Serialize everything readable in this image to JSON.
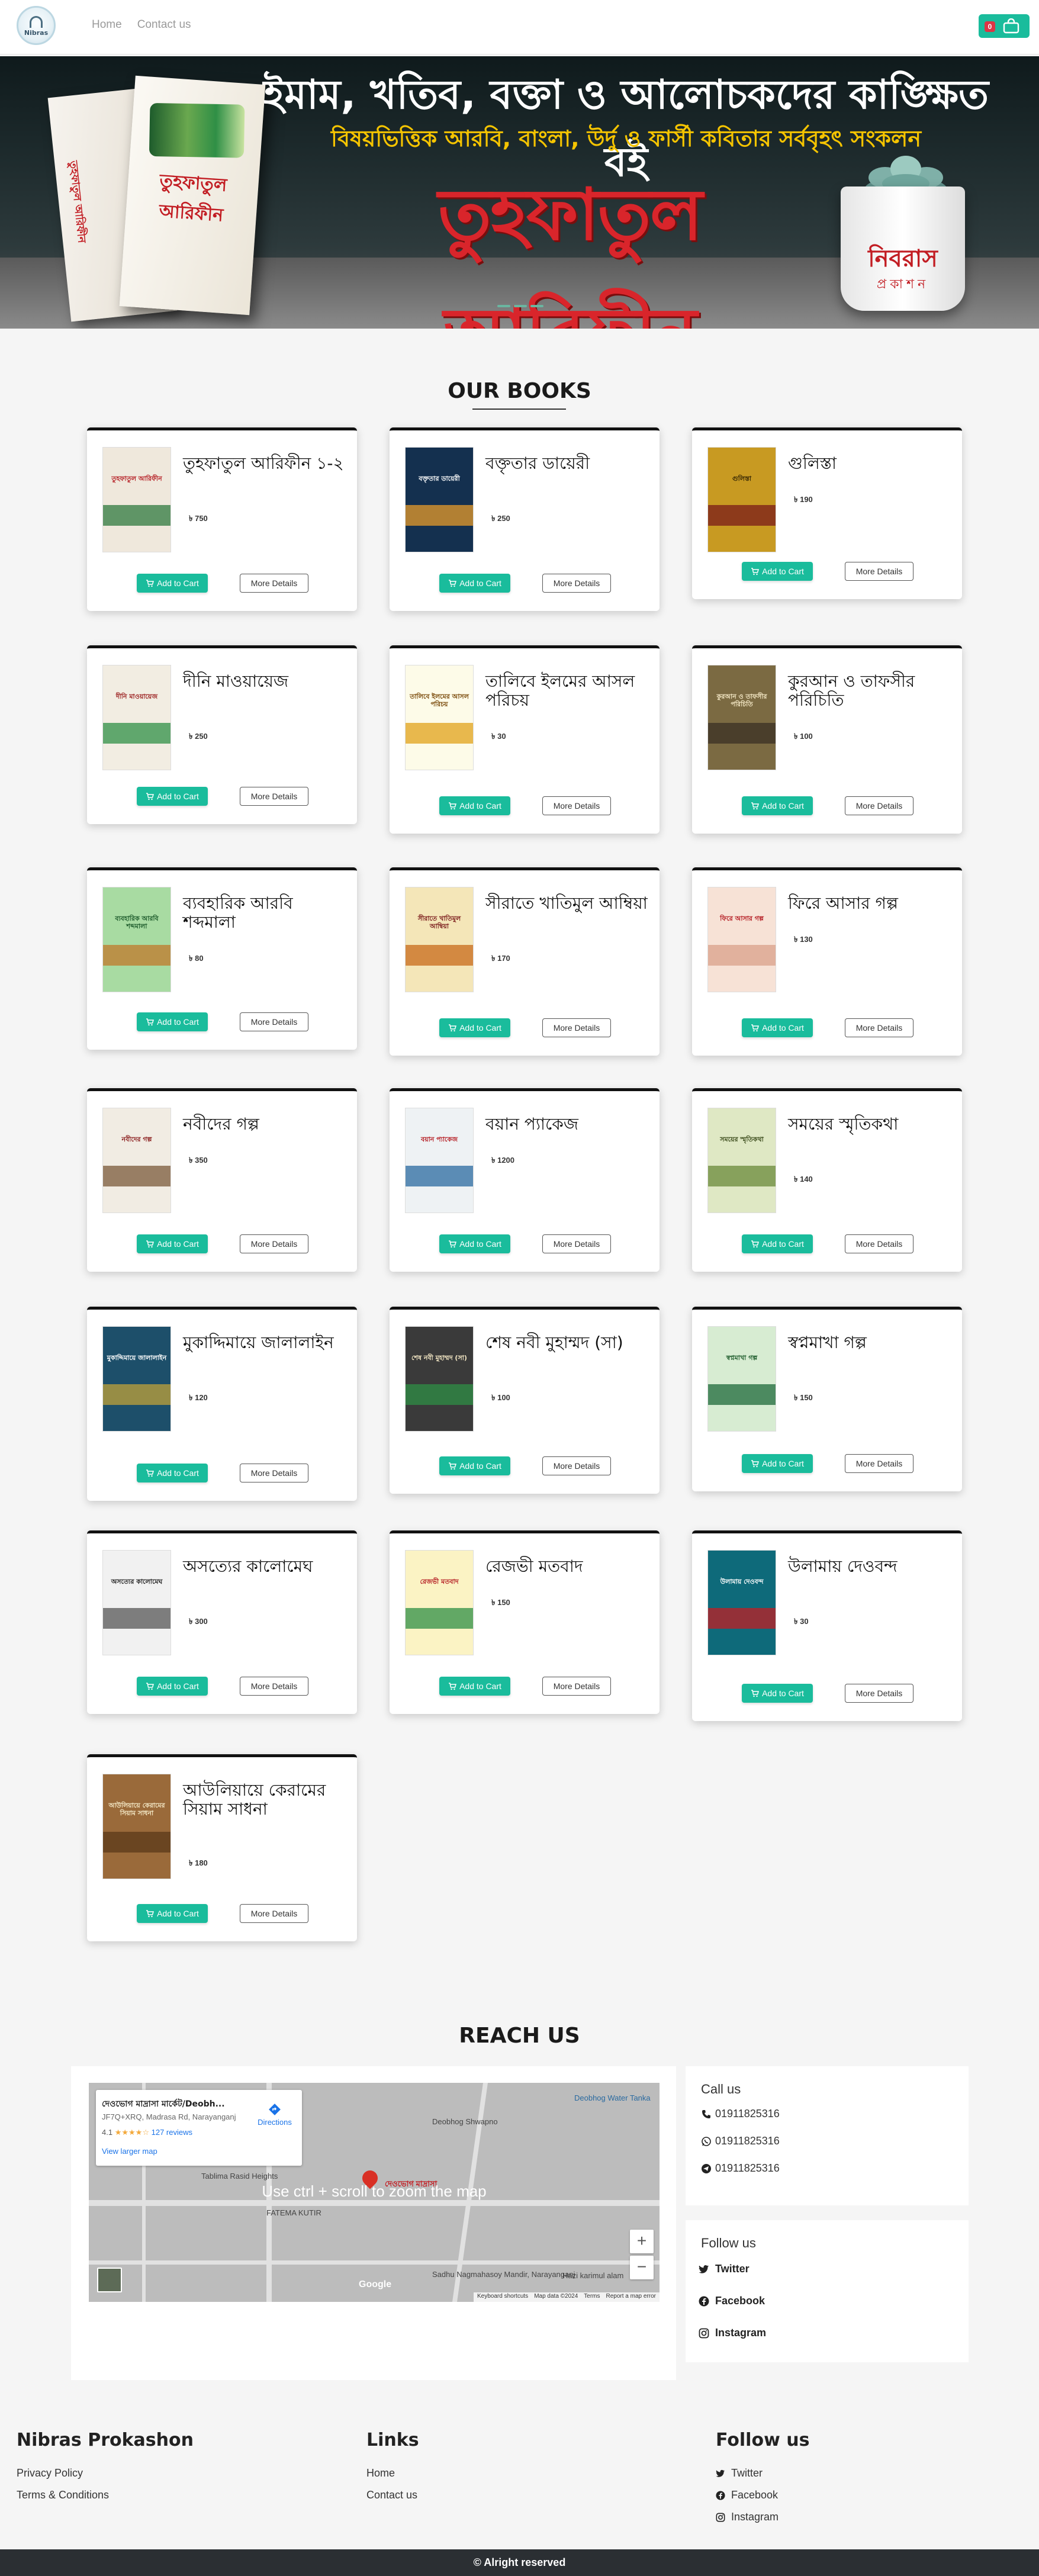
{
  "nav": {
    "logo_text": "Nibras",
    "links": [
      "Home",
      "Contact us"
    ],
    "cart_count": "0"
  },
  "banner": {
    "line1": "ইমাম, খতিব, বক্তা ও আলোচকদের কাঙ্ক্ষিত বই",
    "line2": "বিষয়ভিত্তিক আরবি, বাংলা, উর্দু ও ফার্সী কবিতার সর্ববৃহৎ সংকলন",
    "line3": "তুহফাতুল আরিফীন",
    "book_title": "তুহফাতুল আরিফীন",
    "pot_label": "নিবরাস",
    "pot_sub": "প্রকাশন"
  },
  "books_section": {
    "title": "OUR BOOKS"
  },
  "buttons": {
    "add_to_cart": "Add to Cart",
    "more_details": "More Details"
  },
  "books": [
    {
      "name": "তুহফাতুল আরিফীন ১-২",
      "price": "৳ 750",
      "cover_color": "#efe8dc",
      "band_color": "#2f7a3f",
      "cover_text": "তুহফাতুল আরিফীন",
      "text_color": "#b51d23"
    },
    {
      "name": "বক্তৃতার ডায়েরী",
      "price": "৳ 250",
      "cover_color": "#14304f",
      "band_color": "#e79b2a",
      "cover_text": "বক্তৃতার ডায়েরী",
      "text_color": "#ffffff"
    },
    {
      "name": "গুলিস্তা",
      "price": "৳ 190",
      "cover_color": "#c89a22",
      "band_color": "#7a1a1a",
      "cover_text": "গুলিস্তা",
      "text_color": "#3a2a05"
    },
    {
      "name": "দীনি মাওয়ায়েজ",
      "price": "৳ 250",
      "cover_color": "#f2ede2",
      "band_color": "#2f8f46",
      "cover_text": "দীনি মাওয়ায়েজ",
      "text_color": "#9a1d1d"
    },
    {
      "name": "তালিবে ইলমের আসল পরিচয়",
      "price": "৳ 30",
      "cover_color": "#fdfbe8",
      "band_color": "#e0a21a",
      "cover_text": "তালিবে ইলমের আসল পরিচয়",
      "text_color": "#7a4a0a"
    },
    {
      "name": "কুরআন ও তাফসীর পরিচিতি",
      "price": "৳ 100",
      "cover_color": "#7b6a42",
      "band_color": "#3a3024",
      "cover_text": "কুরআন ও তাফসীর পরিচিতি",
      "text_color": "#f3e7c4"
    },
    {
      "name": "ব্যবহারিক আরবি শব্দমালা",
      "price": "৳ 80",
      "cover_color": "#a8dba2",
      "band_color": "#c0782a",
      "cover_text": "ব্যবহারিক আরবি শব্দমালা",
      "text_color": "#1e5c2c"
    },
    {
      "name": "সীরাতে খাতিমুল আম্বিয়া",
      "price": "৳ 170",
      "cover_color": "#f4e6b8",
      "band_color": "#c86a1a",
      "cover_text": "সীরাতে খাতিমুল আম্বিয়া",
      "text_color": "#7a1a1a"
    },
    {
      "name": "ফিরে আসার গল্প",
      "price": "৳ 130",
      "cover_color": "#f7e2d6",
      "band_color": "#d9a08a",
      "cover_text": "ফিরে আসার গল্প",
      "text_color": "#b51d23"
    },
    {
      "name": "নবীদের গল্প",
      "price": "৳ 350",
      "cover_color": "#f1ece3",
      "band_color": "#7a5a3a",
      "cover_text": "নবীদের গল্প",
      "text_color": "#8a1d1d"
    },
    {
      "name": "বয়ান প্যাকেজ",
      "price": "৳ 1200",
      "cover_color": "#eef2f4",
      "band_color": "#2a6aa0",
      "cover_text": "বয়ান প্যাকেজ",
      "text_color": "#b51d23"
    },
    {
      "name": "সময়ের স্মৃতিকথা",
      "price": "৳ 140",
      "cover_color": "#dfe8c4",
      "band_color": "#6a8a3a",
      "cover_text": "সময়ের স্মৃতিকথা",
      "text_color": "#3a4a1a"
    },
    {
      "name": "মুকাদ্দিমায়ে জালালাইন",
      "price": "৳ 120",
      "cover_color": "#1d4f6a",
      "band_color": "#c0a23a",
      "cover_text": "মুকাদ্দিমায়ে জালালাইন",
      "text_color": "#ffffff"
    },
    {
      "name": "শেষ নবী মুহাম্মদ (সা)",
      "price": "৳ 100",
      "cover_color": "#3a3a3a",
      "band_color": "#2f8f46",
      "cover_text": "শেষ নবী মুহাম্মদ (সা)",
      "text_color": "#f3e7c4"
    },
    {
      "name": "স্বপ্নমাখা গল্প",
      "price": "৳ 150",
      "cover_color": "#d7ecd2",
      "band_color": "#1e6a3a",
      "cover_text": "স্বপ্নমাখা গল্প",
      "text_color": "#1e5c2c"
    },
    {
      "name": "অসত্যের কালোমেঘ",
      "price": "৳ 300",
      "cover_color": "#f1f1f1",
      "band_color": "#555555",
      "cover_text": "অসত্যের কালোমেঘ",
      "text_color": "#222222"
    },
    {
      "name": "রেজভী মতবাদ",
      "price": "৳ 150",
      "cover_color": "#fbf3c4",
      "band_color": "#2f8f46",
      "cover_text": "রেজভী মতবাদ",
      "text_color": "#b51d23"
    },
    {
      "name": "উলামায় দেওবন্দ",
      "price": "৳ 30",
      "cover_color": "#0e6a7a",
      "band_color": "#c21d23",
      "cover_text": "উলামায় দেওবন্দ",
      "text_color": "#ffffff"
    },
    {
      "name": "আউলিয়ায়ে কেরামের সিয়াম সাধনা",
      "price": "৳ 180",
      "cover_color": "#9a6a3a",
      "band_color": "#5a3a1a",
      "cover_text": "আউলিয়ায়ে কেরামের সিয়াম সাধনা",
      "text_color": "#f3e7c4"
    }
  ],
  "reach": {
    "title": "REACH US",
    "map": {
      "place_name": "দেওভোগ মাদ্রাসা মার্কেট/Deobh...",
      "address": "JF7Q+XRQ, Madrasa Rd, Narayanganj",
      "rating": "4.1",
      "stars": "★★★★☆",
      "reviews": "127 reviews",
      "larger_map": "View larger map",
      "directions": "Directions",
      "hint": "Use ctrl + scroll to zoom the map",
      "label_top_right": "Deobhog Water Tanka",
      "label_market": "Deobhog Shwapno",
      "label_market_short": "দেওভোগ মাদ্রাসা",
      "label_road": "Tablima Rasid Heights",
      "label_fatema": "FATEMA KUTIR",
      "label_sadhu": "Sadhu Nagmahasoy Mandir, Narayanganj",
      "label_hazi": "Hazi karimul alam",
      "footer": [
        "Keyboard shortcuts",
        "Map data ©2024",
        "Terms",
        "Report a map error"
      ],
      "google": "Google"
    },
    "call": {
      "heading": "Call us",
      "lines": [
        "01911825316",
        "01911825316",
        "01911825316"
      ]
    },
    "follow": {
      "heading": "Follow us",
      "items": [
        "Twitter",
        "Facebook",
        "Instagram"
      ]
    }
  },
  "footer": {
    "brand": {
      "heading": "Nibras Prokashon",
      "links": [
        "Privacy Policy",
        "Terms & Conditions"
      ]
    },
    "links": {
      "heading": "Links",
      "links": [
        "Home",
        "Contact us"
      ]
    },
    "follow": {
      "heading": "Follow us",
      "links": [
        "Twitter",
        "Facebook",
        "Instagram"
      ]
    }
  },
  "copyright": "© Alright reserved"
}
